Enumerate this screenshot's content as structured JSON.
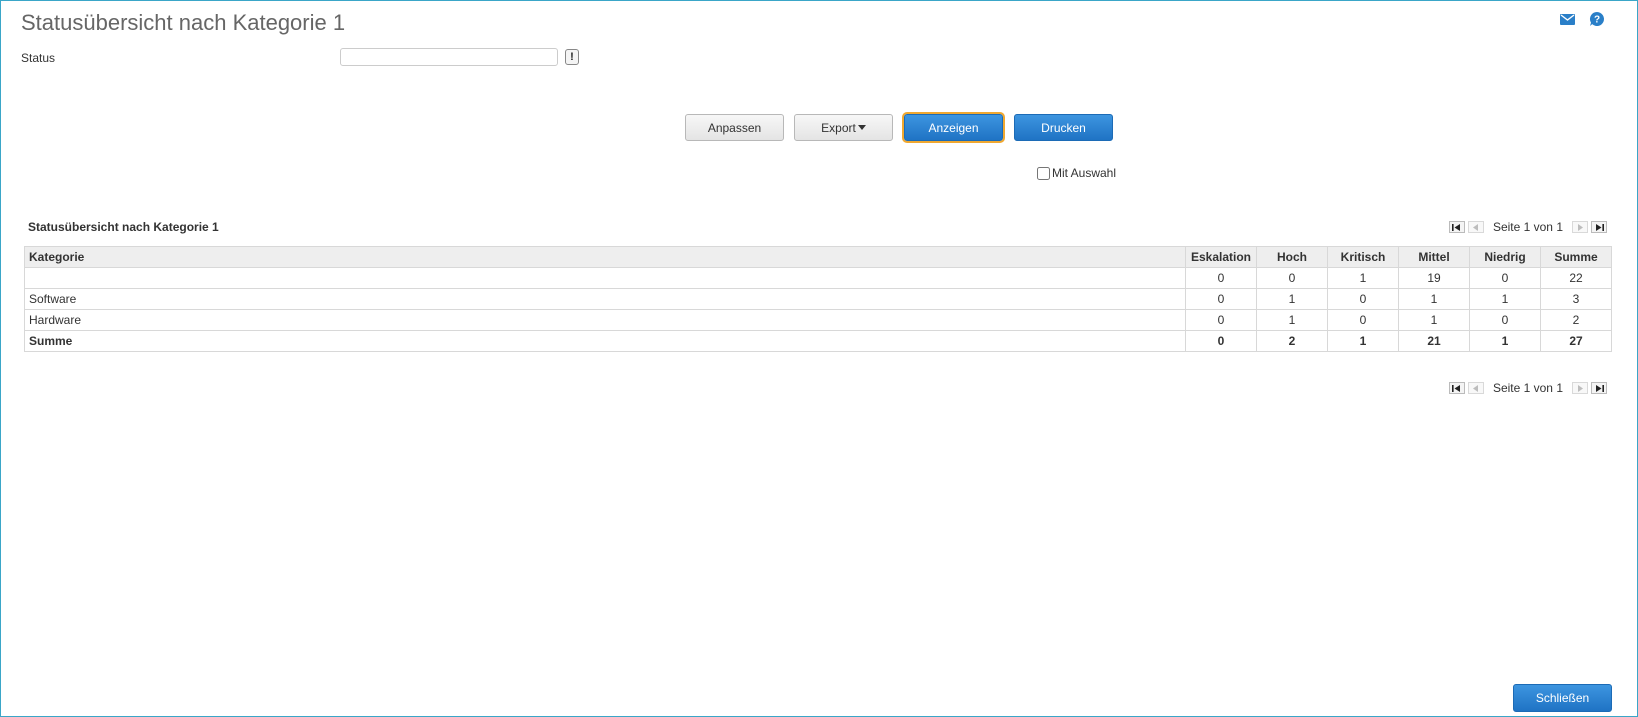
{
  "header": {
    "title": "Statusübersicht nach Kategorie 1",
    "icons": [
      "mail-icon",
      "help-icon"
    ]
  },
  "filter": {
    "status_label": "Status",
    "status_value": "",
    "status_placeholder": "",
    "exclaim_label": "!"
  },
  "toolbar": {
    "customize_label": "Anpassen",
    "export_label": "Export",
    "show_label": "Anzeigen",
    "print_label": "Drucken"
  },
  "options": {
    "with_selection_label": "Mit Auswahl",
    "with_selection_checked": false
  },
  "report": {
    "title": "Statusübersicht nach Kategorie 1",
    "pager_text": "Seite 1 von 1",
    "columns": [
      "Kategorie",
      "Eskalation",
      "Hoch",
      "Kritisch",
      "Mittel",
      "Niedrig",
      "Summe"
    ],
    "rows": [
      {
        "category": "",
        "values": [
          "0",
          "0",
          "1",
          "19",
          "0",
          "22"
        ]
      },
      {
        "category": "Software",
        "values": [
          "0",
          "1",
          "0",
          "1",
          "1",
          "3"
        ]
      },
      {
        "category": "Hardware",
        "values": [
          "0",
          "1",
          "0",
          "1",
          "0",
          "2"
        ]
      }
    ],
    "total": {
      "category": "Summe",
      "values": [
        "0",
        "2",
        "1",
        "21",
        "1",
        "27"
      ]
    }
  },
  "footer": {
    "close_label": "Schließen"
  },
  "colors": {
    "accent": "#1f73c4",
    "frame_border": "#3aa6c8",
    "focus_outline": "#f0a830"
  }
}
